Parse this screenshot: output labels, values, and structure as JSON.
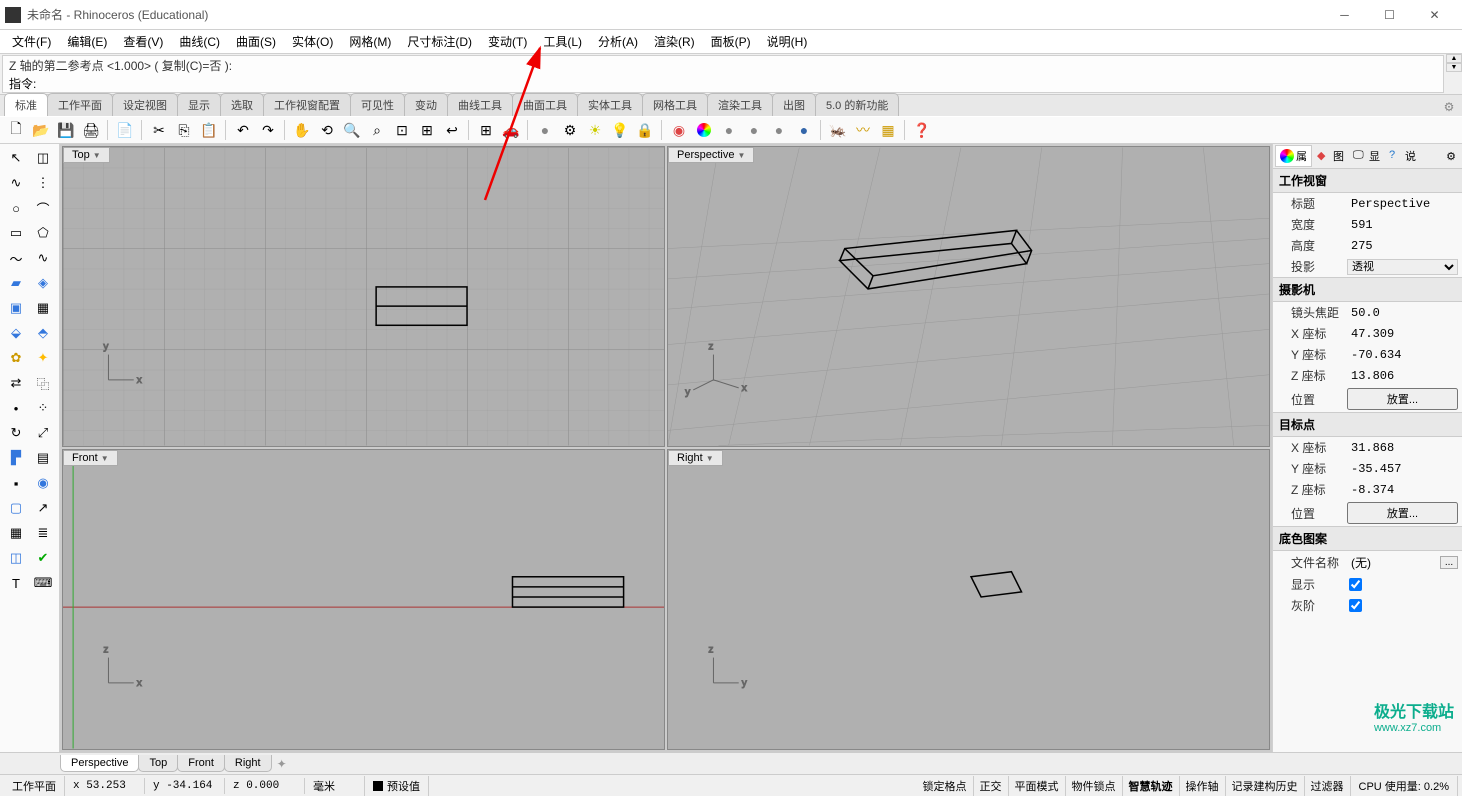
{
  "window": {
    "title": "未命名 - Rhinoceros (Educational)"
  },
  "menu": {
    "items": [
      "文件(F)",
      "编辑(E)",
      "查看(V)",
      "曲线(C)",
      "曲面(S)",
      "实体(O)",
      "网格(M)",
      "尺寸标注(D)",
      "变动(T)",
      "工具(L)",
      "分析(A)",
      "渲染(R)",
      "面板(P)",
      "说明(H)"
    ]
  },
  "command": {
    "history": "Z 轴的第二参考点 <1.000> ( 复制(C)=否 ):",
    "prompt": "指令:"
  },
  "tooltabs": [
    "标准",
    "工作平面",
    "设定视图",
    "显示",
    "选取",
    "工作视窗配置",
    "可见性",
    "变动",
    "曲线工具",
    "曲面工具",
    "实体工具",
    "网格工具",
    "渲染工具",
    "出图",
    "5.0 的新功能"
  ],
  "viewports": {
    "top": {
      "label": "Top"
    },
    "perspective": {
      "label": "Perspective"
    },
    "front": {
      "label": "Front"
    },
    "right": {
      "label": "Right"
    }
  },
  "vptabs": [
    "Perspective",
    "Top",
    "Front",
    "Right"
  ],
  "panels": {
    "tabs": [
      {
        "label": "属",
        "color": "#f00"
      },
      {
        "label": "图",
        "icon": "layers"
      },
      {
        "label": "显",
        "icon": "monitor"
      },
      {
        "label": "说",
        "icon": "help"
      }
    ],
    "sections": {
      "viewport_title": "工作视窗",
      "viewport": {
        "title_lbl": "标题",
        "title_val": "Perspective",
        "width_lbl": "宽度",
        "width_val": "591",
        "height_lbl": "高度",
        "height_val": "275",
        "proj_lbl": "投影",
        "proj_val": "透视"
      },
      "camera_title": "摄影机",
      "camera": {
        "focal_lbl": "镜头焦距",
        "focal_val": "50.0",
        "x_lbl": "X 座标",
        "x_val": "47.309",
        "y_lbl": "Y 座标",
        "y_val": "-70.634",
        "z_lbl": "Z 座标",
        "z_val": "13.806",
        "pos_lbl": "位置",
        "pos_btn": "放置..."
      },
      "target_title": "目标点",
      "target": {
        "x_lbl": "X 座标",
        "x_val": "31.868",
        "y_lbl": "Y 座标",
        "y_val": "-35.457",
        "z_lbl": "Z 座标",
        "z_val": "-8.374",
        "pos_lbl": "位置",
        "pos_btn": "放置..."
      },
      "bg_title": "底色图案",
      "bg": {
        "file_lbl": "文件名称",
        "file_val": "(无)",
        "show_lbl": "显示",
        "gray_lbl": "灰阶"
      }
    }
  },
  "status": {
    "cplane": "工作平面",
    "x": "x 53.253",
    "y": "y -34.164",
    "z": "z 0.000",
    "units": "毫米",
    "preset": "预设值",
    "snap": "锁定格点",
    "ortho": "正交",
    "planar": "平面模式",
    "osnap": "物件锁点",
    "smarttrack": "智慧轨迹",
    "gumball": "操作轴",
    "record": "记录建构历史",
    "filter": "过滤器",
    "cpu": "CPU 使用量: 0.2%"
  },
  "watermark": {
    "line1": "极光下载站",
    "line2": "www.xz7.com"
  }
}
